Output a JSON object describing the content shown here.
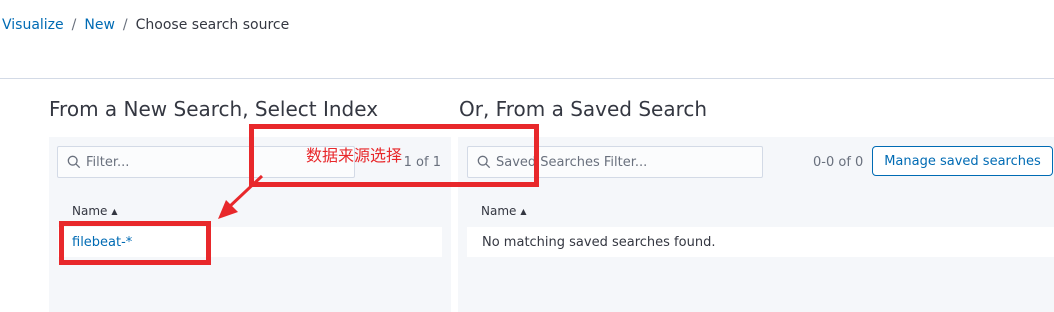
{
  "breadcrumb": {
    "items": [
      {
        "label": "Visualize"
      },
      {
        "label": "New"
      }
    ],
    "separator": "/",
    "current": "Choose search source"
  },
  "left_panel": {
    "title": "From a New Search, Select Index",
    "search_placeholder": "Filter...",
    "pager": "1 of 1",
    "column_header": "Name",
    "rows": [
      "filebeat-*"
    ]
  },
  "right_panel": {
    "title": "Or, From a Saved Search",
    "search_placeholder": "Saved Searches Filter...",
    "pager": "0-0 of 0",
    "manage_button": "Manage saved searches",
    "column_header": "Name",
    "empty_message": "No matching saved searches found."
  },
  "annotation": {
    "label": "数据来源选择",
    "color": "#e8282b"
  },
  "colors": {
    "link": "#006bb4",
    "panel_bg": "#f5f7fa",
    "text": "#343741"
  },
  "icons": [
    "search-icon",
    "sort-ascending-icon",
    "arrow-annotation"
  ]
}
